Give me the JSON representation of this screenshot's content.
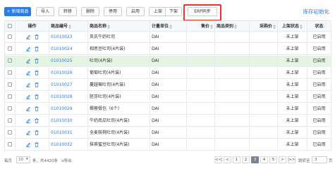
{
  "toolbar": {
    "buttons": [
      "+ 新增商品",
      "导入",
      "转移",
      "删除",
      "停用",
      "启用",
      "上架",
      "下架",
      "ERP同步"
    ],
    "library_link": "库存初始化"
  },
  "table": {
    "headers": [
      "操作",
      "商品编号",
      "商品名称",
      "计量单位",
      "售价",
      "商品类别",
      "采购价",
      "上架状态",
      "状态"
    ],
    "rows": [
      {
        "code": "01010023",
        "name": "英氏牛奶吐司",
        "unit": "DAI",
        "state": "未上架",
        "status": "已启用"
      },
      {
        "code": "01010024",
        "name": "相思豆吐司(4片装)",
        "unit": "DAI",
        "state": "未上架",
        "status": "已启用"
      },
      {
        "code": "01010025",
        "name": "吐司(4片装)",
        "unit": "DAI",
        "state": "未上架",
        "status": "已启用"
      },
      {
        "code": "01010026",
        "name": "葡萄吐司(4片装)",
        "unit": "DAI",
        "state": "未上架",
        "status": "已启用"
      },
      {
        "code": "01010027",
        "name": "蔓越莓吐司(4片装)",
        "unit": "DAI",
        "state": "未上架",
        "status": "已启用"
      },
      {
        "code": "01010028",
        "name": "胚芽吐司(4片装)",
        "unit": "DAI",
        "state": "未上架",
        "status": "已启用"
      },
      {
        "code": "01010029",
        "name": "椰蓉餐包（6个）",
        "unit": "DAI",
        "state": "未上架",
        "status": "已启用"
      },
      {
        "code": "01010030",
        "name": "牛奶南瓜吐司(4片装)",
        "unit": "DAI",
        "state": "未上架",
        "status": "已启用"
      },
      {
        "code": "01010031",
        "name": "全麦核桃吐司(4片装)",
        "unit": "DAI",
        "state": "未上架",
        "status": "已启用"
      },
      {
        "code": "01010032",
        "name": "抹茶蜜豆吐司(4片装)",
        "unit": "DAI",
        "state": "未上架",
        "status": "已启用"
      }
    ]
  },
  "pagination": {
    "per_page_label": "每页",
    "per_page": "10",
    "summary": "条，共4420条",
    "export": "导出",
    "pages": [
      "<<",
      "<",
      "1",
      "2",
      "3",
      "4",
      "5",
      ">",
      ">>"
    ],
    "current": "3",
    "jump_label": "跳转至",
    "jump_value": "3",
    "jump_unit": "页"
  },
  "colors": {
    "primary": "#2d7be5",
    "highlight": "#e0372c",
    "selected_row": "#e4f5e4"
  }
}
